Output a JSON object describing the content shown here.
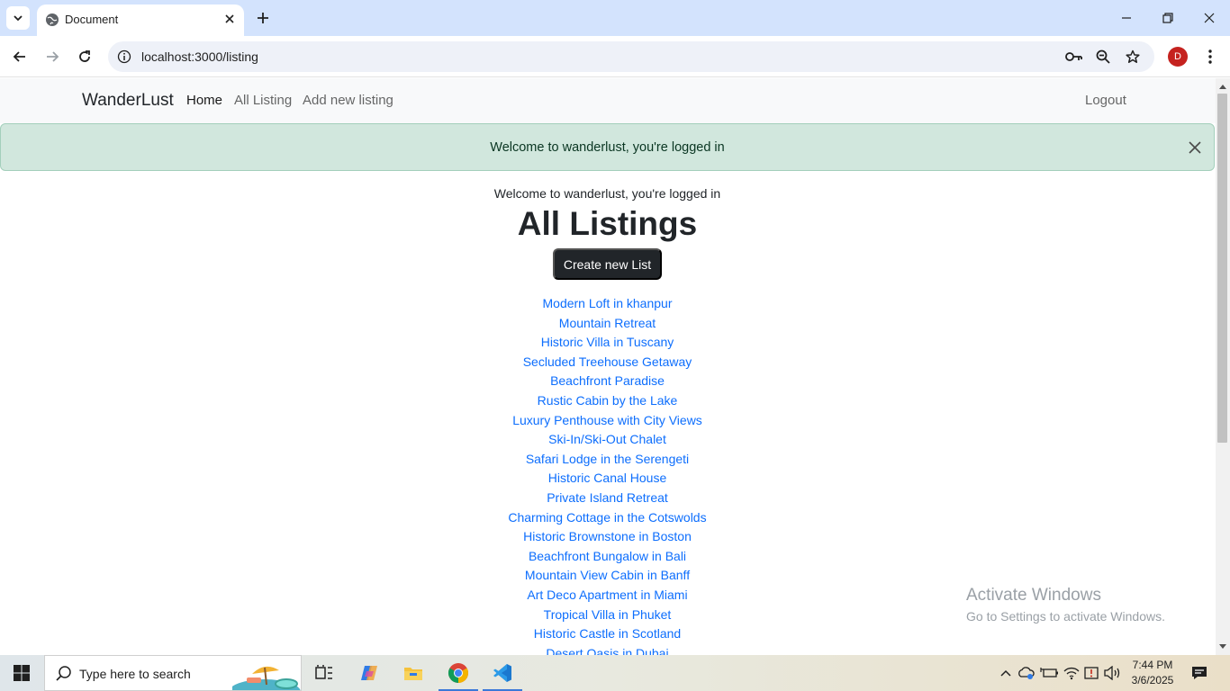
{
  "browser": {
    "tab_title": "Document",
    "url": "localhost:3000/listing",
    "profile_initial": "D"
  },
  "navbar": {
    "brand": "WanderLust",
    "links": [
      {
        "label": "Home",
        "active": true
      },
      {
        "label": "All Listing",
        "active": false
      },
      {
        "label": "Add new listing",
        "active": false
      }
    ],
    "logout": "Logout"
  },
  "alert": {
    "message": "Welcome to wanderlust, you're logged in"
  },
  "page": {
    "welcome_text": "Welcome to wanderlust, you're logged in",
    "heading": "All Listings",
    "create_button": "Create new List",
    "listings": [
      "Modern Loft in khanpur",
      "Mountain Retreat",
      "Historic Villa in Tuscany",
      "Secluded Treehouse Getaway",
      "Beachfront Paradise",
      "Rustic Cabin by the Lake",
      "Luxury Penthouse with City Views",
      "Ski-In/Ski-Out Chalet",
      "Safari Lodge in the Serengeti",
      "Historic Canal House",
      "Private Island Retreat",
      "Charming Cottage in the Cotswolds",
      "Historic Brownstone in Boston",
      "Beachfront Bungalow in Bali",
      "Mountain View Cabin in Banff",
      "Art Deco Apartment in Miami",
      "Tropical Villa in Phuket",
      "Historic Castle in Scotland",
      "Desert Oasis in Dubai"
    ]
  },
  "watermark": {
    "title": "Activate Windows",
    "subtitle": "Go to Settings to activate Windows."
  },
  "taskbar": {
    "search_placeholder": "Type here to search",
    "time": "7:44 PM",
    "date": "3/6/2025"
  },
  "colors": {
    "link": "#0d6efd",
    "alert_bg": "#d1e7dd",
    "button_dark": "#212529",
    "tab_strip": "#d3e3fd"
  }
}
